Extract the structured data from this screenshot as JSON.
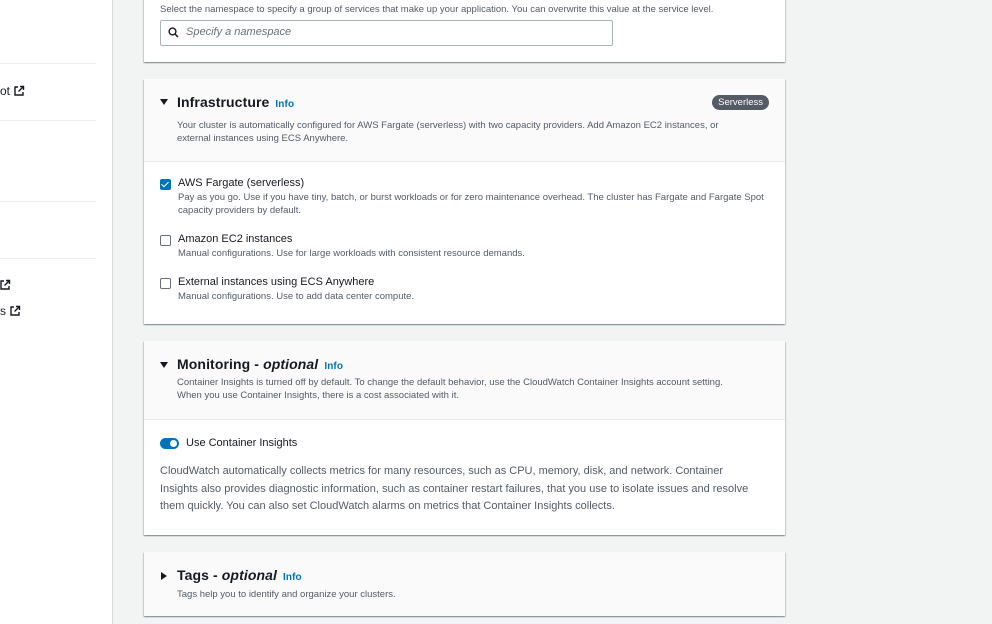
{
  "sidebar": {
    "links": [
      {
        "label": "ot"
      },
      {
        "label": ""
      },
      {
        "label": "s"
      }
    ]
  },
  "namespace": {
    "description": "Select the namespace to specify a group of services that make up your application. You can overwrite this value at the service level.",
    "placeholder": "Specify a namespace"
  },
  "infrastructure": {
    "title": "Infrastructure",
    "info": "Info",
    "badge": "Serverless",
    "description": "Your cluster is automatically configured for AWS Fargate (serverless) with two capacity providers. Add Amazon EC2 instances, or external instances using ECS Anywhere.",
    "options": [
      {
        "label": "AWS Fargate (serverless)",
        "checked": true,
        "description": "Pay as you go. Use if you have tiny, batch, or burst workloads or for zero maintenance overhead. The cluster has Fargate and Fargate Spot capacity providers by default."
      },
      {
        "label": "Amazon EC2 instances",
        "checked": false,
        "description": "Manual configurations. Use for large workloads with consistent resource demands."
      },
      {
        "label": "External instances using ECS Anywhere",
        "checked": false,
        "description": "Manual configurations. Use to add data center compute."
      }
    ]
  },
  "monitoring": {
    "title": "Monitoring - ",
    "optional": "optional",
    "info": "Info",
    "description": "Container Insights is turned off by default. To change the default behavior, use the CloudWatch Container Insights account setting. When you use Container Insights, there is a cost associated with it.",
    "toggle_label": "Use Container Insights",
    "toggle_on": true,
    "body": "CloudWatch automatically collects metrics for many resources, such as CPU, memory, disk, and network. Container Insights also provides diagnostic information, such as container restart failures, that you use to isolate issues and resolve them quickly. You can also set CloudWatch alarms on metrics that Container Insights collects."
  },
  "tags": {
    "title": "Tags - ",
    "optional": "optional",
    "info": "Info",
    "description": "Tags help you to identify and organize your clusters."
  },
  "colors": {
    "accent": "#0073bb",
    "badge": "#545b64"
  }
}
